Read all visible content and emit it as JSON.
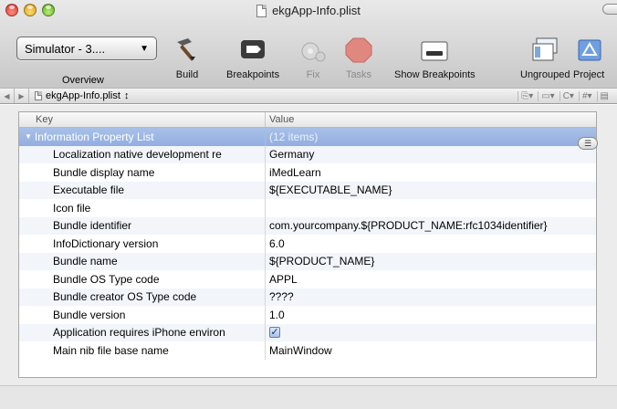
{
  "window": {
    "title": "ekgApp-Info.plist"
  },
  "toolbar": {
    "scheme_select": "Simulator - 3....",
    "overview_label": "Overview",
    "build_label": "Build",
    "breakpoints_label": "Breakpoints",
    "fix_label": "Fix",
    "tasks_label": "Tasks",
    "show_breakpoints_label": "Show Breakpoints",
    "ungrouped_label": "Ungrouped",
    "project_label": "Project"
  },
  "navbar": {
    "file_name": "ekgApp-Info.plist",
    "selector_glyph": "↕"
  },
  "table": {
    "headers": {
      "key": "Key",
      "value": "Value"
    },
    "root": {
      "key": "Information Property List",
      "value": "(12 items)"
    },
    "rows": [
      {
        "key": "Localization native development re",
        "value": "Germany"
      },
      {
        "key": "Bundle display name",
        "value": "iMedLearn"
      },
      {
        "key": "Executable file",
        "value": "${EXECUTABLE_NAME}"
      },
      {
        "key": "Icon file",
        "value": ""
      },
      {
        "key": "Bundle identifier",
        "value": "com.yourcompany.${PRODUCT_NAME:rfc1034identifier}"
      },
      {
        "key": "InfoDictionary version",
        "value": "6.0"
      },
      {
        "key": "Bundle name",
        "value": "${PRODUCT_NAME}"
      },
      {
        "key": "Bundle OS Type code",
        "value": "APPL"
      },
      {
        "key": "Bundle creator OS Type code",
        "value": "????"
      },
      {
        "key": "Bundle version",
        "value": "1.0"
      },
      {
        "key": "Application requires iPhone environ",
        "value": "checked"
      },
      {
        "key": "Main nib file base name",
        "value": "MainWindow"
      }
    ]
  },
  "colors": {
    "selection": "#9bb5e3",
    "stop_red": "#d9453a"
  }
}
